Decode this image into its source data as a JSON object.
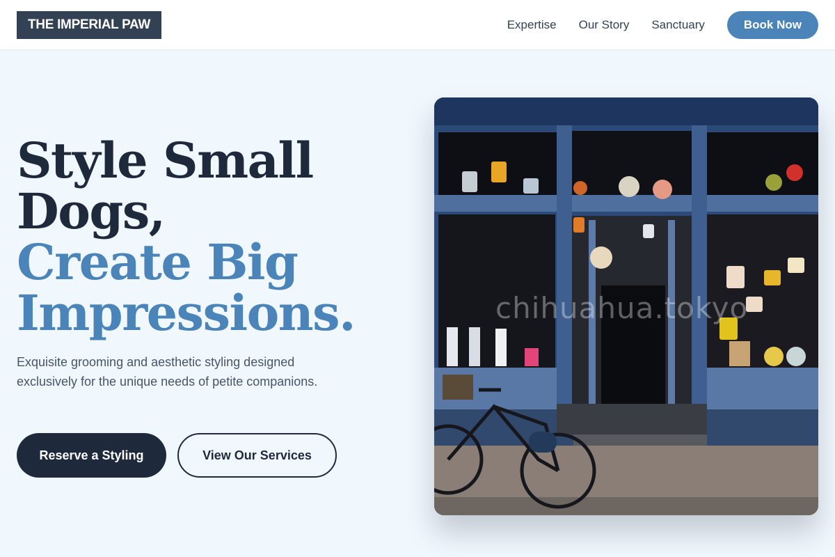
{
  "header": {
    "logo": "THE IMPERIAL PAW",
    "nav": [
      "Expertise",
      "Our Story",
      "Sanctuary"
    ],
    "cta": "Book Now"
  },
  "hero": {
    "title_line1": "Style Small",
    "title_line2": "Dogs,",
    "title_accent1": "Create Big",
    "title_accent2": "Impressions.",
    "subtitle": "Exquisite grooming and aesthetic styling designed exclusively for the unique needs of petite companions.",
    "primary_button": "Reserve a Styling",
    "secondary_button": "View Our Services",
    "image_watermark": "chihuahua.tokyo"
  },
  "colors": {
    "accent": "#4a84b8",
    "dark": "#1e293b",
    "background": "#f0f7fd"
  }
}
